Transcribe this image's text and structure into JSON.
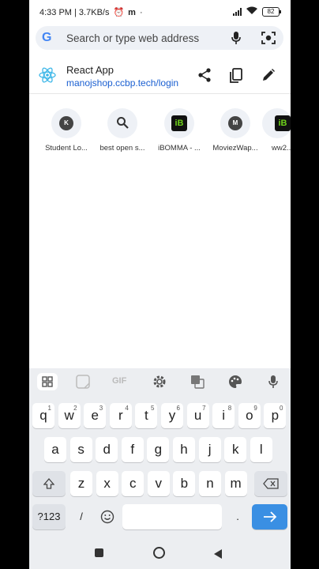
{
  "status_bar": {
    "time_speed": "4:33 PM | 3.7KB/s",
    "battery": "82"
  },
  "omnibox": {
    "google_letter": "G",
    "placeholder": "Search or type web address"
  },
  "suggestion": {
    "title": "React App",
    "url": "manojshop.ccbp.tech/login"
  },
  "tiles": [
    {
      "initial": "K",
      "label": "Student Lo..."
    },
    {
      "initial": "",
      "label": "best open s..."
    },
    {
      "initial": "iB",
      "label": "iBOMMA - ..."
    },
    {
      "initial": "M",
      "label": "MoviezWap..."
    },
    {
      "initial": "iB",
      "label": "ww2..."
    }
  ],
  "keyboard": {
    "row1": [
      {
        "k": "q",
        "n": "1"
      },
      {
        "k": "w",
        "n": "2"
      },
      {
        "k": "e",
        "n": "3"
      },
      {
        "k": "r",
        "n": "4"
      },
      {
        "k": "t",
        "n": "5"
      },
      {
        "k": "y",
        "n": "6"
      },
      {
        "k": "u",
        "n": "7"
      },
      {
        "k": "i",
        "n": "8"
      },
      {
        "k": "o",
        "n": "9"
      },
      {
        "k": "p",
        "n": "0"
      }
    ],
    "row2": [
      "a",
      "s",
      "d",
      "f",
      "g",
      "h",
      "j",
      "k",
      "l"
    ],
    "row3": [
      "z",
      "x",
      "c",
      "v",
      "b",
      "n",
      "m"
    ],
    "symbols": "?123",
    "slash": "/",
    "period": ".",
    "gif": "GIF"
  },
  "colors": {
    "accent": "#3a8fe3",
    "link": "#1a5fd1"
  }
}
